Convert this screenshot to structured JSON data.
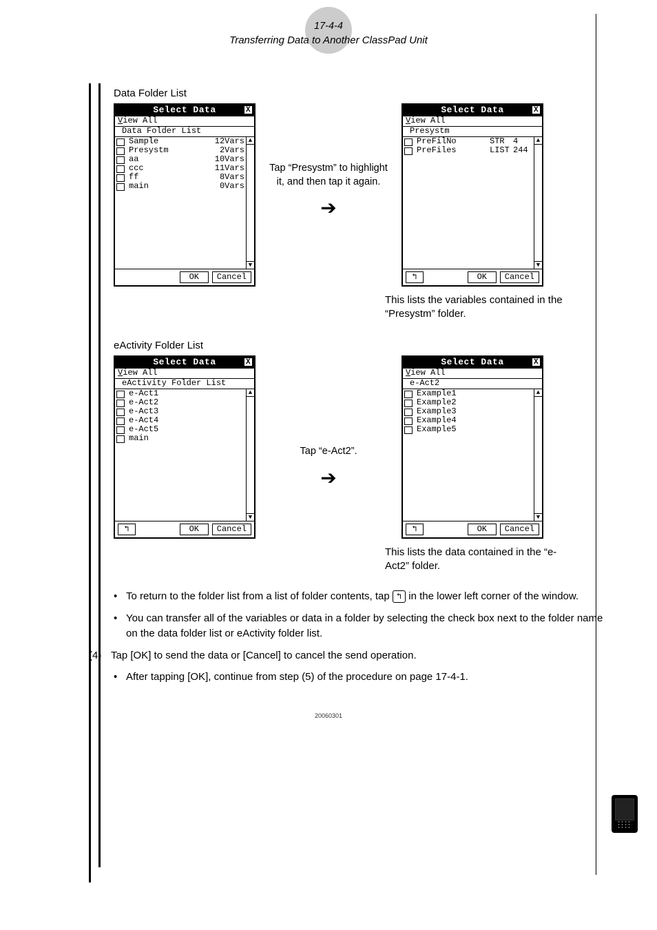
{
  "header": {
    "pageNum": "17-4-4",
    "title": "Transferring Data to Another ClassPad Unit"
  },
  "sectionA": {
    "label": "Data Folder List",
    "panelLeft": {
      "title": "Select Data",
      "menu1": "V",
      "menu2": "iew All",
      "path": "Data Folder List",
      "rows": [
        {
          "name": "Sample",
          "vars": "12Vars"
        },
        {
          "name": "Presystm",
          "vars": "2Vars"
        },
        {
          "name": "aa",
          "vars": "10Vars"
        },
        {
          "name": "ccc",
          "vars": "11Vars"
        },
        {
          "name": "ff",
          "vars": "8Vars"
        },
        {
          "name": "main",
          "vars": "0Vars"
        }
      ],
      "ok": "OK",
      "cancel": "Cancel"
    },
    "midText": "Tap “Presystm” to highlight it, and then tap it again.",
    "panelRight": {
      "title": "Select Data",
      "menu1": "V",
      "menu2": "iew All",
      "path": "Presystm",
      "rows": [
        {
          "name": "PreFilNo",
          "type": "STR",
          "size": "4"
        },
        {
          "name": "PreFiles",
          "type": "LIST",
          "size": "244"
        }
      ],
      "ok": "OK",
      "cancel": "Cancel"
    },
    "caption": "This lists the variables contained in the “Presystm” folder."
  },
  "sectionB": {
    "label": "eActivity Folder List",
    "panelLeft": {
      "title": "Select Data",
      "menu1": "V",
      "menu2": "iew All",
      "path": "eActivity Folder List",
      "rows": [
        {
          "name": "e-Act1"
        },
        {
          "name": "e-Act2"
        },
        {
          "name": "e-Act3"
        },
        {
          "name": "e-Act4"
        },
        {
          "name": "e-Act5"
        },
        {
          "name": "main"
        }
      ],
      "ok": "OK",
      "cancel": "Cancel"
    },
    "midText": "Tap “e-Act2”.",
    "panelRight": {
      "title": "Select Data",
      "menu1": "V",
      "menu2": "iew All",
      "path": "e-Act2",
      "rows": [
        {
          "name": "Example1"
        },
        {
          "name": "Example2"
        },
        {
          "name": "Example3"
        },
        {
          "name": "Example4"
        },
        {
          "name": "Example5"
        }
      ],
      "ok": "OK",
      "cancel": "Cancel"
    },
    "caption": "This lists the data contained in the “e-Act2” folder."
  },
  "body": {
    "b1a": "To return to the folder list from a list of folder contents, tap ",
    "b1b": " in the lower left corner of the window.",
    "b2": "You can transfer all of the variables or data in a folder by selecting the check box next to the folder name on the data folder list or eActivity folder list.",
    "step4num": "(4)",
    "step4": "Tap [OK] to send the data or [Cancel] to cancel the send operation.",
    "step4b": "After tapping [OK], continue from step (5) of the procedure on page 17-4-1."
  },
  "footer": "20060301"
}
